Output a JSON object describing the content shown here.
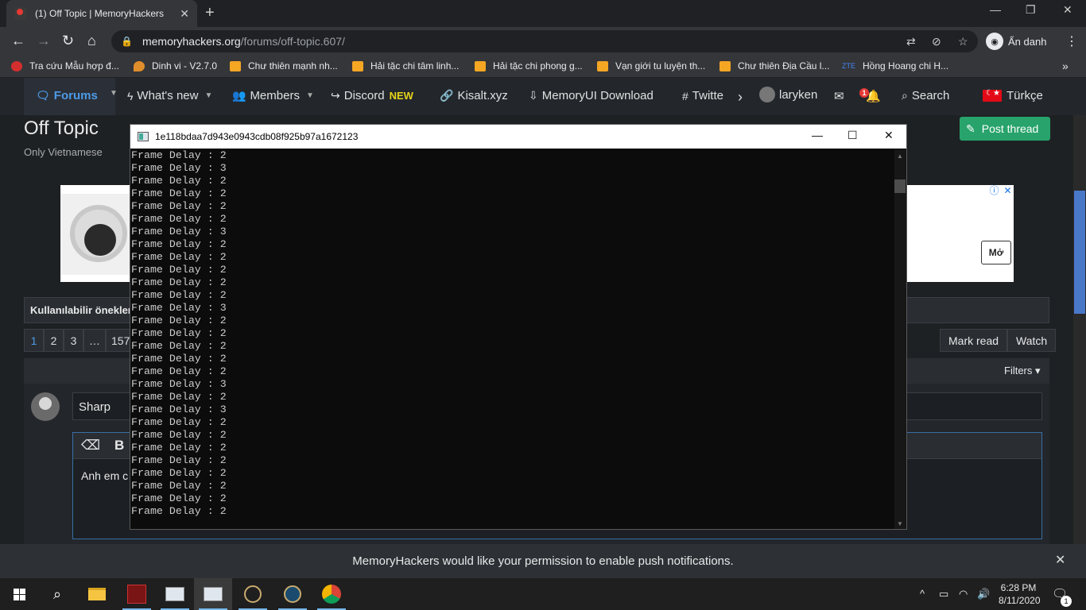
{
  "browser": {
    "tab_title": "(1) Off Topic | MemoryHackers",
    "tab_close": "✕",
    "new_tab": "+",
    "url_host": "memoryhackers.org",
    "url_path": "/forums/off-topic.607/",
    "profile_label": "Ẩn danh",
    "bookmarks": [
      {
        "label": "Tra cứu Mẫu hợp đ...",
        "color": "#d32f2f"
      },
      {
        "label": "Dinh vi - V2.7.0",
        "color": "#e08e2b"
      },
      {
        "label": "Chư thiên mạnh nh...",
        "color": "#f5a623"
      },
      {
        "label": "Hải tặc chi tâm linh...",
        "color": "#f5a623"
      },
      {
        "label": "Hải tặc chi phong g...",
        "color": "#f5a623"
      },
      {
        "label": "Vạn giới tu luyện th...",
        "color": "#f5a623"
      },
      {
        "label": "Chư thiên Địa Cầu l...",
        "color": "#f5a623"
      },
      {
        "label": "Hồng Hoang chi H...",
        "color": "#4285f4"
      }
    ],
    "bookmark_zte": "ZTE",
    "bookmarks_more": "»"
  },
  "sitenav": {
    "forums": "Forums",
    "whats_new": "What's new",
    "members": "Members",
    "discord": "Discord",
    "discord_badge": "NEW",
    "kisalt": "Kisalt.xyz",
    "memoryui": "MemoryUI Download",
    "twitter": "Twitte",
    "username": "laryken",
    "alert_count": "1",
    "search": "Search",
    "language": "Türkçe"
  },
  "page": {
    "title": "Off Topic",
    "subtitle": "Only Vietnamese",
    "post_thread": "Post thread",
    "ad_open": "Mở",
    "prefix_label": "Kullanılabilir önekler:",
    "pages": [
      "1",
      "2",
      "3",
      "…",
      "157"
    ],
    "mark_read": "Mark read",
    "watch": "Watch",
    "filters": "Filters ▾",
    "thread_title_value": "Sharp",
    "editor_text": "Anh em c",
    "push_message": "MemoryHackers would like your permission to enable push notifications."
  },
  "console": {
    "title": "1e118bdaa7d943e0943cdb08f925b97a1672123",
    "line_prefix": "Frame Delay : ",
    "delays": [
      2,
      3,
      2,
      2,
      2,
      2,
      3,
      2,
      2,
      2,
      2,
      2,
      3,
      2,
      2,
      2,
      2,
      2,
      3,
      2,
      3,
      2,
      2,
      2,
      2,
      2,
      2,
      2,
      2
    ]
  },
  "taskbar": {
    "time": "6:28 PM",
    "date": "8/11/2020",
    "notification_count": "1"
  },
  "colors": {
    "accent": "#4c9ae6",
    "post_button": "#27a36b",
    "console_bg": "#0c0c0c"
  }
}
